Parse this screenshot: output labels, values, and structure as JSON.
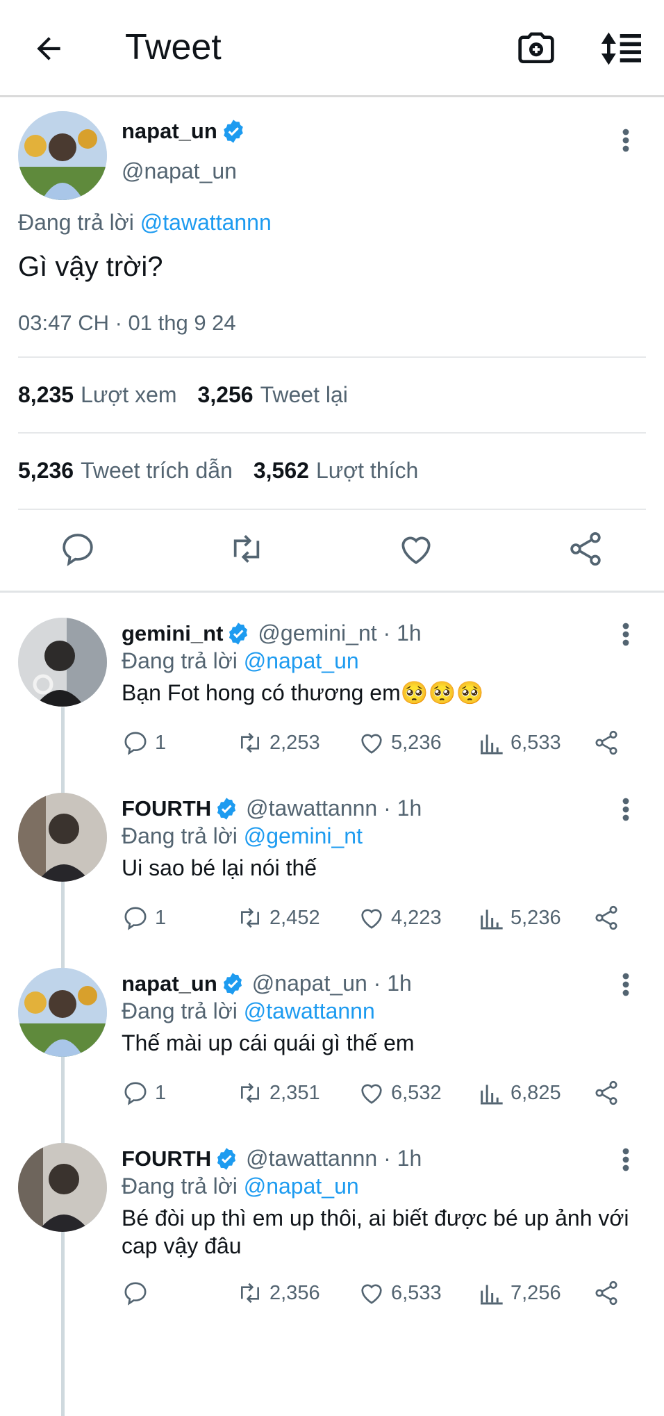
{
  "header": {
    "title": "Tweet"
  },
  "main_tweet": {
    "name": "napat_un",
    "handle": "@napat_un",
    "reply_prefix": "Đang trả lời",
    "reply_to": "@tawattannn",
    "text": "Gì vậy trời?",
    "timestamp": "03:47 CH · 01 thg 9 24",
    "stats": {
      "views_count": "8,235",
      "views_label": "Lượt xem",
      "retweets_count": "3,256",
      "retweets_label": "Tweet lại",
      "quotes_count": "5,236",
      "quotes_label": "Tweet trích dẫn",
      "likes_count": "3,562",
      "likes_label": "Lượt thích"
    }
  },
  "replies": [
    {
      "name": "gemini_nt",
      "handle": "@gemini_nt · 1h",
      "reply_prefix": "Đang trả lời",
      "reply_to": "@napat_un",
      "text": "Bạn Fot hong có thương em🥺🥺🥺",
      "replies": "1",
      "retweets": "2,253",
      "likes": "5,236",
      "views": "6,533"
    },
    {
      "name": "FOURTH",
      "handle": "@tawattannn · 1h",
      "reply_prefix": "Đang trả lời",
      "reply_to": "@gemini_nt",
      "text": "Ui sao bé lại nói thế",
      "replies": "1",
      "retweets": "2,452",
      "likes": "4,223",
      "views": "5,236"
    },
    {
      "name": "napat_un",
      "handle": "@napat_un · 1h",
      "reply_prefix": "Đang trả lời",
      "reply_to": "@tawattannn",
      "text": "Thế mài up cái quái gì thế em",
      "replies": "1",
      "retweets": "2,351",
      "likes": "6,532",
      "views": "6,825"
    },
    {
      "name": "FOURTH",
      "handle": "@tawattannn · 1h",
      "reply_prefix": "Đang trả lời",
      "reply_to": "@napat_un",
      "text": "Bé đòi up thì em up thôi, ai biết được bé up ảnh với cap vậy đâu",
      "replies": "",
      "retweets": "2,356",
      "likes": "6,533",
      "views": "7,256"
    }
  ],
  "colors": {
    "accent": "#1d9bf0",
    "muted": "#536471",
    "text": "#0f1419"
  }
}
